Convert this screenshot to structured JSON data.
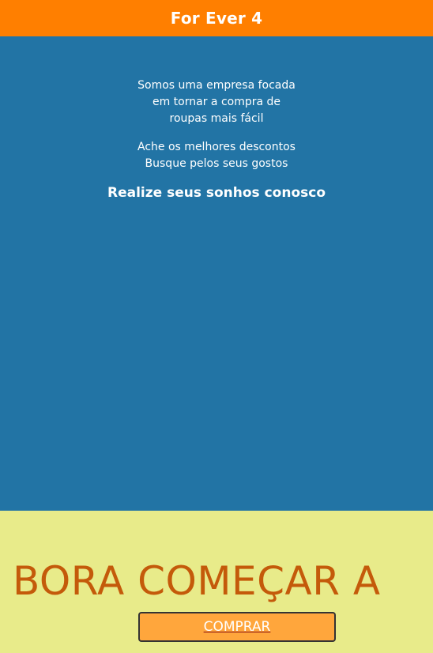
{
  "header": {
    "brand": "For Ever 4"
  },
  "hero": {
    "about_line_1": "Somos uma empresa focada",
    "about_line_2": "em tornar a compra de",
    "about_line_3": "roupas mais fácil",
    "benefit_line_1": "Ache os melhores descontos",
    "benefit_line_2": "Busque pelos seus gostos",
    "tagline": "Realize seus sonhos conosco"
  },
  "cta": {
    "headline": "BORA COMEÇAR A",
    "button_label": "COMPRAR"
  },
  "colors": {
    "header_bg": "#ff7f00",
    "hero_bg": "#2274a5",
    "cta_bg": "#e8eb8a",
    "headline_text": "#c45a0a",
    "button_bg": "#ffa63c"
  }
}
